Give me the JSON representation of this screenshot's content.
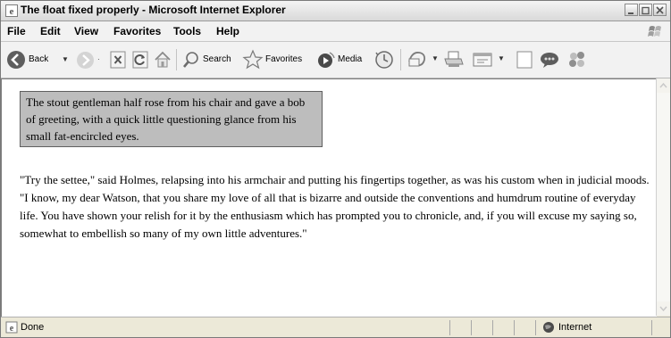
{
  "window": {
    "title": "The float fixed properly - Microsoft Internet Explorer"
  },
  "menu": {
    "items": [
      "File",
      "Edit",
      "View",
      "Favorites",
      "Tools",
      "Help"
    ]
  },
  "toolbar": {
    "back_label": "Back",
    "search_label": "Search",
    "favorites_label": "Favorites",
    "media_label": "Media"
  },
  "page": {
    "float_text": "The stout gentleman half rose from his chair and gave a bob of greeting, with a quick little questioning glance from his small fat-encircled eyes.",
    "paragraph": "\"Try the settee,\" said Holmes, relapsing into his armchair and putting his fingertips together, as was his custom when in judicial moods. \"I know, my dear Watson, that you share my love of all that is bizarre and outside the conventions and humdrum routine of everyday life. You have shown your relish for it by the enthusiasm which has prompted you to chronicle, and, if you will excuse my saying so, somewhat to embellish so many of my own little adventures.\""
  },
  "status": {
    "text": "Done",
    "zone": "Internet"
  },
  "icons": [
    "ie-icon",
    "windows-logo-icon",
    "back-icon",
    "forward-icon",
    "stop-icon",
    "refresh-icon",
    "home-icon",
    "search-icon",
    "favorites-icon",
    "media-icon",
    "history-icon",
    "mail-icon",
    "print-icon",
    "edit-icon",
    "discuss-icon",
    "messenger-icon",
    "globe-icon"
  ],
  "colors": {
    "float_bg": "#bdbdbd",
    "chrome": "#ece9d8",
    "toolbar": "#f2f2f2"
  }
}
